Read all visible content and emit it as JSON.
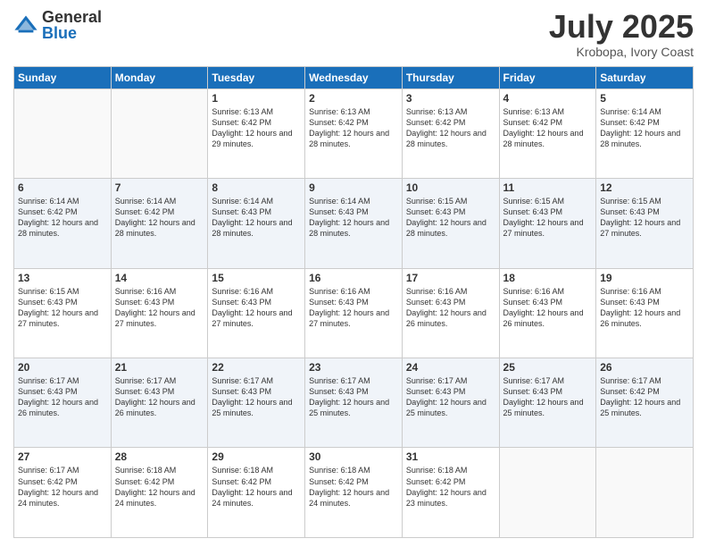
{
  "logo": {
    "general": "General",
    "blue": "Blue"
  },
  "title": {
    "month_year": "July 2025",
    "location": "Krobopa, Ivory Coast"
  },
  "days_of_week": [
    "Sunday",
    "Monday",
    "Tuesday",
    "Wednesday",
    "Thursday",
    "Friday",
    "Saturday"
  ],
  "weeks": [
    [
      {
        "day": "",
        "info": ""
      },
      {
        "day": "",
        "info": ""
      },
      {
        "day": "1",
        "info": "Sunrise: 6:13 AM\nSunset: 6:42 PM\nDaylight: 12 hours and 29 minutes."
      },
      {
        "day": "2",
        "info": "Sunrise: 6:13 AM\nSunset: 6:42 PM\nDaylight: 12 hours and 28 minutes."
      },
      {
        "day": "3",
        "info": "Sunrise: 6:13 AM\nSunset: 6:42 PM\nDaylight: 12 hours and 28 minutes."
      },
      {
        "day": "4",
        "info": "Sunrise: 6:13 AM\nSunset: 6:42 PM\nDaylight: 12 hours and 28 minutes."
      },
      {
        "day": "5",
        "info": "Sunrise: 6:14 AM\nSunset: 6:42 PM\nDaylight: 12 hours and 28 minutes."
      }
    ],
    [
      {
        "day": "6",
        "info": "Sunrise: 6:14 AM\nSunset: 6:42 PM\nDaylight: 12 hours and 28 minutes."
      },
      {
        "day": "7",
        "info": "Sunrise: 6:14 AM\nSunset: 6:42 PM\nDaylight: 12 hours and 28 minutes."
      },
      {
        "day": "8",
        "info": "Sunrise: 6:14 AM\nSunset: 6:43 PM\nDaylight: 12 hours and 28 minutes."
      },
      {
        "day": "9",
        "info": "Sunrise: 6:14 AM\nSunset: 6:43 PM\nDaylight: 12 hours and 28 minutes."
      },
      {
        "day": "10",
        "info": "Sunrise: 6:15 AM\nSunset: 6:43 PM\nDaylight: 12 hours and 28 minutes."
      },
      {
        "day": "11",
        "info": "Sunrise: 6:15 AM\nSunset: 6:43 PM\nDaylight: 12 hours and 27 minutes."
      },
      {
        "day": "12",
        "info": "Sunrise: 6:15 AM\nSunset: 6:43 PM\nDaylight: 12 hours and 27 minutes."
      }
    ],
    [
      {
        "day": "13",
        "info": "Sunrise: 6:15 AM\nSunset: 6:43 PM\nDaylight: 12 hours and 27 minutes."
      },
      {
        "day": "14",
        "info": "Sunrise: 6:16 AM\nSunset: 6:43 PM\nDaylight: 12 hours and 27 minutes."
      },
      {
        "day": "15",
        "info": "Sunrise: 6:16 AM\nSunset: 6:43 PM\nDaylight: 12 hours and 27 minutes."
      },
      {
        "day": "16",
        "info": "Sunrise: 6:16 AM\nSunset: 6:43 PM\nDaylight: 12 hours and 27 minutes."
      },
      {
        "day": "17",
        "info": "Sunrise: 6:16 AM\nSunset: 6:43 PM\nDaylight: 12 hours and 26 minutes."
      },
      {
        "day": "18",
        "info": "Sunrise: 6:16 AM\nSunset: 6:43 PM\nDaylight: 12 hours and 26 minutes."
      },
      {
        "day": "19",
        "info": "Sunrise: 6:16 AM\nSunset: 6:43 PM\nDaylight: 12 hours and 26 minutes."
      }
    ],
    [
      {
        "day": "20",
        "info": "Sunrise: 6:17 AM\nSunset: 6:43 PM\nDaylight: 12 hours and 26 minutes."
      },
      {
        "day": "21",
        "info": "Sunrise: 6:17 AM\nSunset: 6:43 PM\nDaylight: 12 hours and 26 minutes."
      },
      {
        "day": "22",
        "info": "Sunrise: 6:17 AM\nSunset: 6:43 PM\nDaylight: 12 hours and 25 minutes."
      },
      {
        "day": "23",
        "info": "Sunrise: 6:17 AM\nSunset: 6:43 PM\nDaylight: 12 hours and 25 minutes."
      },
      {
        "day": "24",
        "info": "Sunrise: 6:17 AM\nSunset: 6:43 PM\nDaylight: 12 hours and 25 minutes."
      },
      {
        "day": "25",
        "info": "Sunrise: 6:17 AM\nSunset: 6:43 PM\nDaylight: 12 hours and 25 minutes."
      },
      {
        "day": "26",
        "info": "Sunrise: 6:17 AM\nSunset: 6:42 PM\nDaylight: 12 hours and 25 minutes."
      }
    ],
    [
      {
        "day": "27",
        "info": "Sunrise: 6:17 AM\nSunset: 6:42 PM\nDaylight: 12 hours and 24 minutes."
      },
      {
        "day": "28",
        "info": "Sunrise: 6:18 AM\nSunset: 6:42 PM\nDaylight: 12 hours and 24 minutes."
      },
      {
        "day": "29",
        "info": "Sunrise: 6:18 AM\nSunset: 6:42 PM\nDaylight: 12 hours and 24 minutes."
      },
      {
        "day": "30",
        "info": "Sunrise: 6:18 AM\nSunset: 6:42 PM\nDaylight: 12 hours and 24 minutes."
      },
      {
        "day": "31",
        "info": "Sunrise: 6:18 AM\nSunset: 6:42 PM\nDaylight: 12 hours and 23 minutes."
      },
      {
        "day": "",
        "info": ""
      },
      {
        "day": "",
        "info": ""
      }
    ]
  ]
}
